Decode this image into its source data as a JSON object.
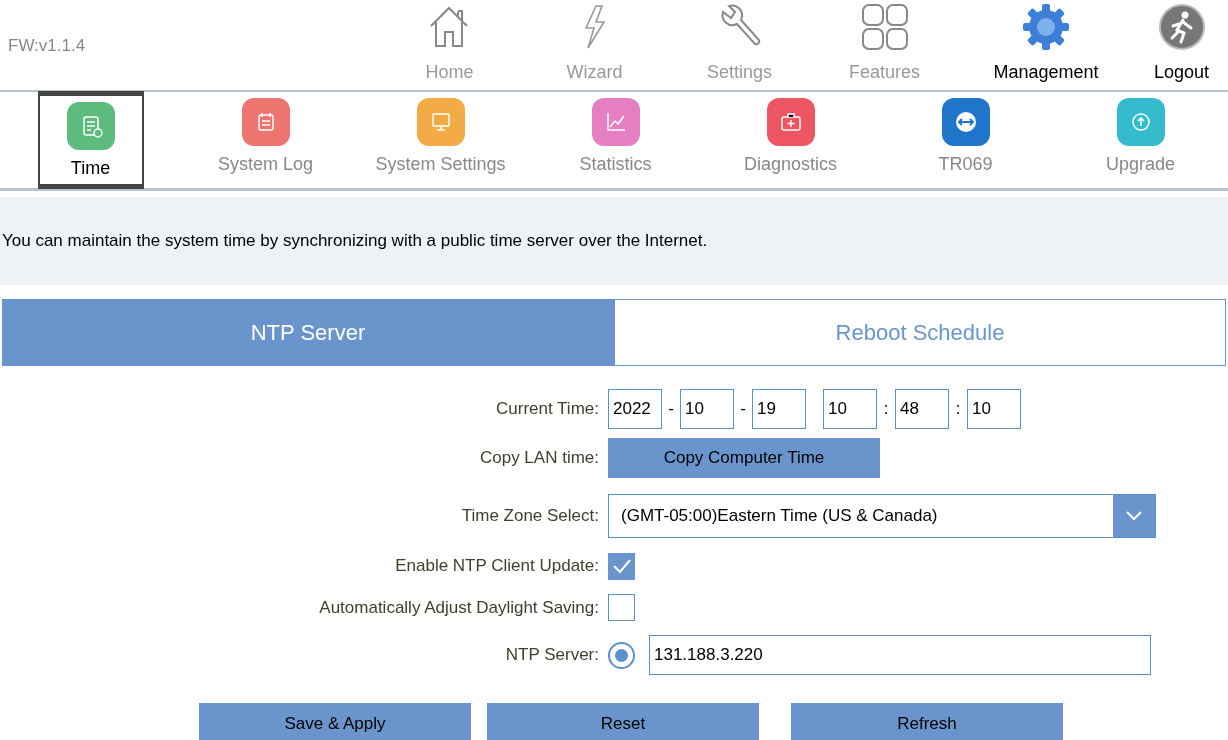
{
  "header": {
    "firmware": "FW:v1.1.4",
    "nav": [
      {
        "label": "Home",
        "kind": "page",
        "selected": false
      },
      {
        "label": "Wizard",
        "kind": "page",
        "selected": false
      },
      {
        "label": "Settings",
        "kind": "page",
        "selected": false
      },
      {
        "label": "Features",
        "kind": "page",
        "selected": false
      },
      {
        "label": "Management",
        "kind": "page",
        "selected": true
      },
      {
        "label": "Logout",
        "kind": "logout"
      }
    ]
  },
  "subnav": [
    {
      "label": "Time",
      "color": "#5dbb7d",
      "selected": true
    },
    {
      "label": "System Log",
      "color": "#ee7470",
      "selected": false
    },
    {
      "label": "System Settings",
      "color": "#f3ab47",
      "selected": false
    },
    {
      "label": "Statistics",
      "color": "#e57fbf",
      "selected": false
    },
    {
      "label": "Diagnostics",
      "color": "#ee5563",
      "selected": false
    },
    {
      "label": "TR069",
      "color": "#1f75c9",
      "selected": false
    },
    {
      "label": "Upgrade",
      "color": "#34bccd",
      "selected": false
    }
  ],
  "description": "You can maintain the system time by synchronizing with a public time server over the Internet.",
  "tabs": [
    {
      "label": "NTP Server",
      "selected": true
    },
    {
      "label": "Reboot Schedule",
      "selected": false
    }
  ],
  "form": [
    {
      "kind": "datetime",
      "label": "Current Time:",
      "parts": [
        {
          "value": "2022"
        },
        {
          "value": "10",
          "prefix": "-"
        },
        {
          "value": "19",
          "prefix": "-"
        },
        {
          "value": "10"
        },
        {
          "value": "48",
          "prefix": ":"
        },
        {
          "value": "10",
          "prefix": ":"
        }
      ]
    },
    {
      "kind": "button",
      "label": "Copy LAN time:",
      "button": "Copy Computer Time"
    },
    {
      "kind": "select",
      "label": "Time Zone Select:",
      "value": "(GMT-05:00)Eastern Time (US & Canada)"
    },
    {
      "kind": "checkbox",
      "label": "Enable NTP Client Update:",
      "checked": true
    },
    {
      "kind": "checkbox",
      "label": "Automatically Adjust Daylight Saving:",
      "checked": false
    },
    {
      "kind": "radio-input",
      "label": "NTP Server:",
      "selected": true,
      "value": "131.188.3.220"
    }
  ],
  "buttons": [
    "Save & Apply",
    "Reset",
    "Refresh"
  ]
}
